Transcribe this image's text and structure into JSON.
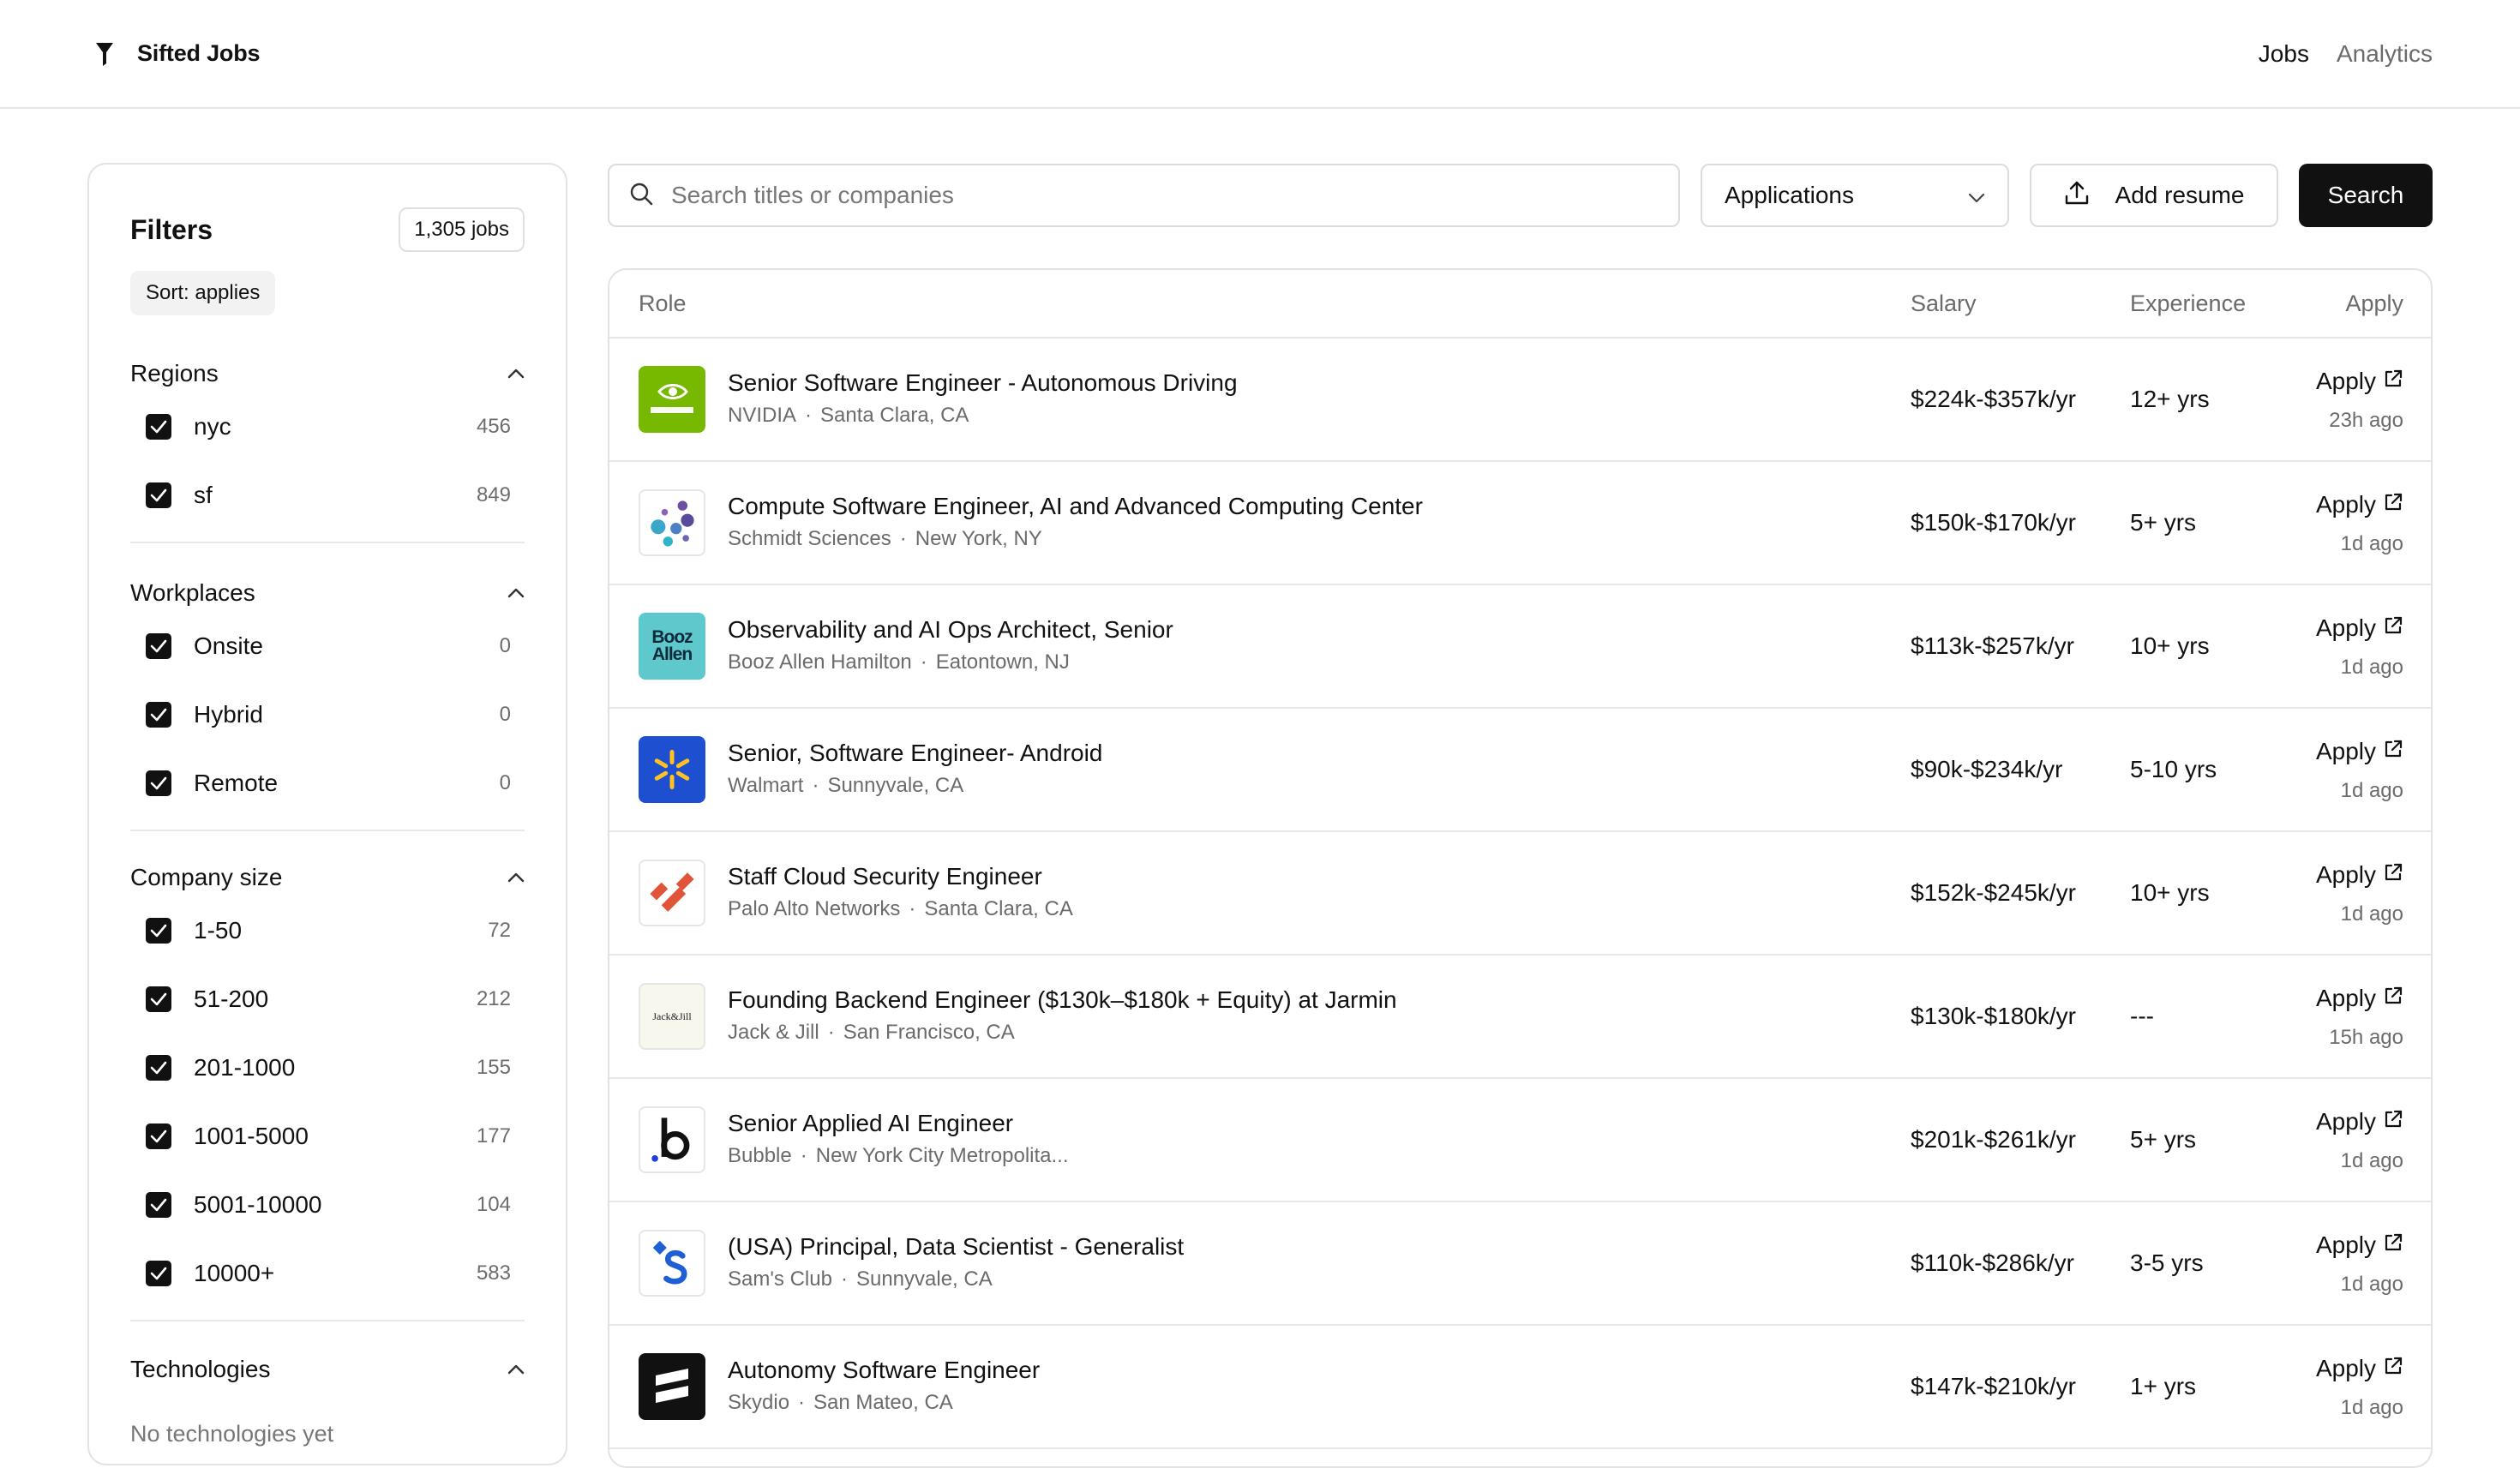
{
  "header": {
    "brand": "Sifted Jobs",
    "nav": [
      {
        "label": "Jobs"
      },
      {
        "label": "Analytics"
      }
    ]
  },
  "filters": {
    "title": "Filters",
    "jobs_count": "1,305 jobs",
    "sort_label": "Sort: applies",
    "groups": [
      {
        "title": "Regions",
        "options": [
          {
            "label": "nyc",
            "count": "456",
            "checked": true
          },
          {
            "label": "sf",
            "count": "849",
            "checked": true
          }
        ]
      },
      {
        "title": "Workplaces",
        "options": [
          {
            "label": "Onsite",
            "count": "0",
            "checked": true
          },
          {
            "label": "Hybrid",
            "count": "0",
            "checked": true
          },
          {
            "label": "Remote",
            "count": "0",
            "checked": true
          }
        ]
      },
      {
        "title": "Company size",
        "options": [
          {
            "label": "1-50",
            "count": "72",
            "checked": true
          },
          {
            "label": "51-200",
            "count": "212",
            "checked": true
          },
          {
            "label": "201-1000",
            "count": "155",
            "checked": true
          },
          {
            "label": "1001-5000",
            "count": "177",
            "checked": true
          },
          {
            "label": "5001-10000",
            "count": "104",
            "checked": true
          },
          {
            "label": "10000+",
            "count": "583",
            "checked": true
          }
        ]
      },
      {
        "title": "Technologies",
        "empty_text": "No technologies yet"
      }
    ]
  },
  "toolbar": {
    "search_placeholder": "Search titles or companies",
    "search_value": "",
    "sort_select": "Applications",
    "add_resume": "Add resume",
    "search_button": "Search"
  },
  "table": {
    "columns": {
      "role": "Role",
      "salary": "Salary",
      "experience": "Experience",
      "apply": "Apply"
    },
    "rows": [
      {
        "title": "Senior Software Engineer - Autonomous Driving",
        "company": "NVIDIA",
        "location": "Santa Clara, CA",
        "salary": "$224k-$357k/yr",
        "experience": "12+ yrs",
        "apply": "Apply",
        "ago": "23h ago",
        "logo": "nvidia-logo"
      },
      {
        "title": "Compute Software Engineer, AI and Advanced Computing Center",
        "company": "Schmidt Sciences",
        "location": "New York, NY",
        "salary": "$150k-$170k/yr",
        "experience": "5+ yrs",
        "apply": "Apply",
        "ago": "1d ago",
        "logo": "schmidt-sciences-logo"
      },
      {
        "title": "Observability and AI Ops Architect, Senior",
        "company": "Booz Allen Hamilton",
        "location": "Eatontown, NJ",
        "salary": "$113k-$257k/yr",
        "experience": "10+ yrs",
        "apply": "Apply",
        "ago": "1d ago",
        "logo": "booz-allen-logo",
        "logo_text": [
          "Booz",
          "Allen"
        ]
      },
      {
        "title": "Senior, Software Engineer- Android",
        "company": "Walmart",
        "location": "Sunnyvale, CA",
        "salary": "$90k-$234k/yr",
        "experience": "5-10 yrs",
        "apply": "Apply",
        "ago": "1d ago",
        "logo": "walmart-logo"
      },
      {
        "title": "Staff Cloud Security Engineer",
        "company": "Palo Alto Networks",
        "location": "Santa Clara, CA",
        "salary": "$152k-$245k/yr",
        "experience": "10+ yrs",
        "apply": "Apply",
        "ago": "1d ago",
        "logo": "palo-alto-logo"
      },
      {
        "title": "Founding Backend Engineer ($130k–$180k + Equity) at Jarmin",
        "company": "Jack & Jill",
        "location": "San Francisco, CA",
        "salary": "$130k-$180k/yr",
        "experience": "---",
        "apply": "Apply",
        "ago": "15h ago",
        "logo": "jack-and-jill-logo",
        "logo_text": "Jack&Jill"
      },
      {
        "title": "Senior Applied AI Engineer",
        "company": "Bubble",
        "location": "New York City Metropolita...",
        "salary": "$201k-$261k/yr",
        "experience": "5+ yrs",
        "apply": "Apply",
        "ago": "1d ago",
        "logo": "bubble-logo"
      },
      {
        "title": "(USA) Principal, Data Scientist - Generalist",
        "company": "Sam's Club",
        "location": "Sunnyvale, CA",
        "salary": "$110k-$286k/yr",
        "experience": "3-5 yrs",
        "apply": "Apply",
        "ago": "1d ago",
        "logo": "sams-club-logo"
      },
      {
        "title": "Autonomy Software Engineer",
        "company": "Skydio",
        "location": "San Mateo, CA",
        "salary": "$147k-$210k/yr",
        "experience": "1+ yrs",
        "apply": "Apply",
        "ago": "1d ago",
        "logo": "skydio-logo"
      }
    ]
  },
  "colors": {
    "primary": "#111111",
    "muted": "#6b6b6b",
    "border": "#e3e3e3",
    "nvidia": "#76b900",
    "booz": "#5ec8cc",
    "walmart": "#1f4fd1",
    "walmart_spark": "#ffc220",
    "palo_alto": "#e0553a",
    "sams": "#1f5fd6"
  }
}
